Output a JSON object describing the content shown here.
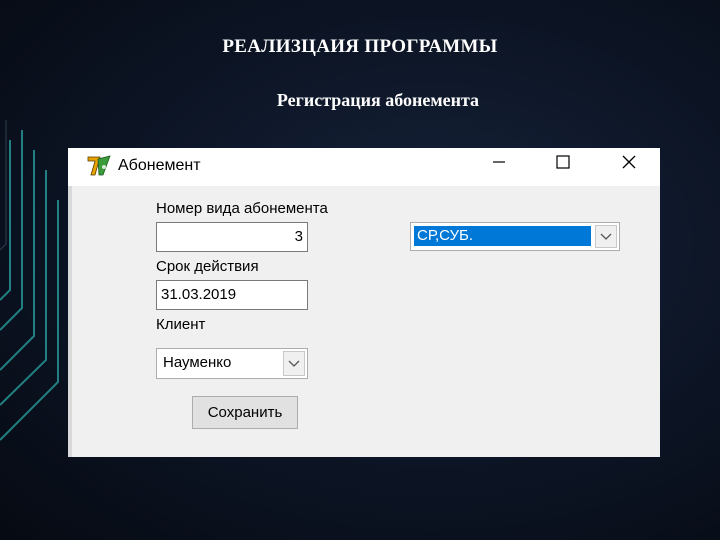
{
  "slide": {
    "title": "РЕАЛИЗЦАИЯ ПРОГРАММЫ",
    "subtitle": "Регистрация абонемента"
  },
  "window": {
    "title": "Абонемент",
    "icon": "delphi-app-icon",
    "controls": [
      "minimize-icon",
      "maximize-icon",
      "close-icon"
    ]
  },
  "form": {
    "subscription_type_label": "Номер вида абонемента",
    "subscription_type_value": "3",
    "validity_label": "Срок действия",
    "validity_value": "31.03.2019",
    "client_label": "Клиент",
    "client_value": "Науменко",
    "days_combo_value": "СР,СУБ.",
    "save_button": "Сохранить"
  },
  "colors": {
    "selection": "#0078d7",
    "window_bg": "#f0f0f0",
    "slide_bg": "#0c1424",
    "accent_lines": "#2aa6a6"
  }
}
